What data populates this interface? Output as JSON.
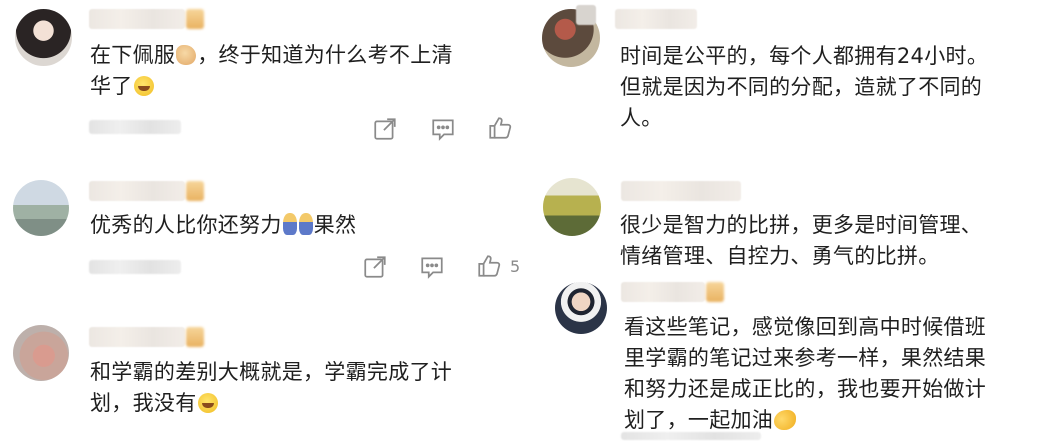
{
  "icons": {
    "share": "share-icon",
    "comment": "comment-icon",
    "like": "thumbs-up-icon"
  },
  "colors": {
    "text": "#1f1f1f",
    "icon": "#8a8a8a",
    "background": "#ffffff"
  },
  "comments_left": [
    {
      "text_a": "在下佩服",
      "text_b": "，终于知道为什么考不上清",
      "text_c": "华了",
      "emojis": [
        "hands",
        "laugh"
      ]
    },
    {
      "text_a": "优秀的人比你还努力",
      "text_b": "果然",
      "emojis": [
        "bow",
        "bow"
      ],
      "like_count": "5"
    },
    {
      "text_a": "和学霸的差别大概就是，学霸完成了计",
      "text_b": "划，我没有",
      "emojis": [
        "laugh"
      ]
    }
  ],
  "comments_right": [
    {
      "line1": "时间是公平的，每个人都拥有24小时。",
      "line2": "但就是因为不同的分配，造就了不同的",
      "line3": "人。"
    },
    {
      "line1": "很少是智力的比拼，更多是时间管理、",
      "line2": "情绪管理、自控力、勇气的比拼。"
    },
    {
      "line1": "看这些笔记，感觉像回到高中时候借班",
      "line2": "里学霸的笔记过来参考一样，果然结果",
      "line3": "和努力还是成正比的，我也要开始做计",
      "line4": "划了，一起加油",
      "emojis": [
        "muscle"
      ]
    }
  ]
}
